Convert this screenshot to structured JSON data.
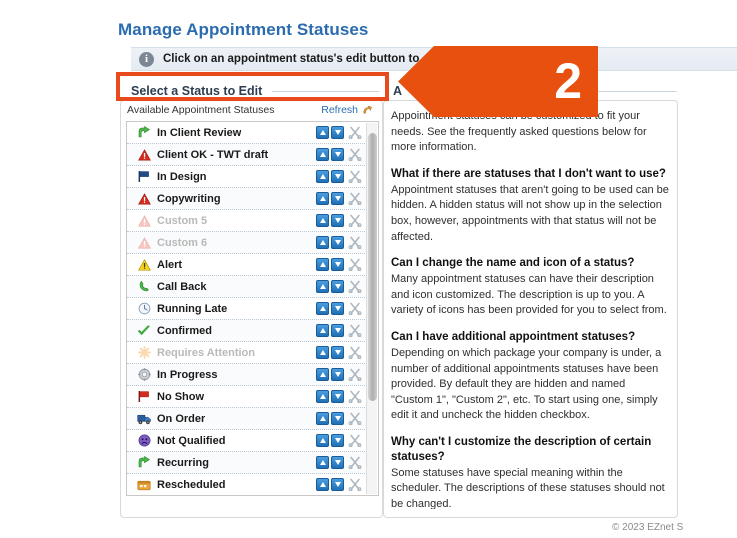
{
  "page": {
    "title": "Manage Appointment Statuses",
    "title_color": "#2b6cb0",
    "footer": "© 2023 EZnet S"
  },
  "info_bar": {
    "icon": "info-icon",
    "text": "Click on an appointment status's edit button to customize it."
  },
  "callout": {
    "number": "2",
    "color": "#e8500f",
    "direction": "left"
  },
  "highlight": {
    "color": "#e8491d"
  },
  "left_panel": {
    "section_title": "Select a Status to Edit",
    "list_header": "Available Appointment Statuses",
    "refresh_label": "Refresh",
    "refresh_icon": "refresh-icon",
    "rows": [
      {
        "name": "In Client Review",
        "icon": "green-arrow-icon",
        "disabled": false
      },
      {
        "name": "Client OK - TWT draft",
        "icon": "red-warning-icon",
        "disabled": false
      },
      {
        "name": "In Design",
        "icon": "blue-flag-icon",
        "disabled": false
      },
      {
        "name": "Copywriting",
        "icon": "red-warning-icon",
        "disabled": false
      },
      {
        "name": "Custom 5",
        "icon": "faded-warning-icon",
        "disabled": true
      },
      {
        "name": "Custom 6",
        "icon": "faded-warning-icon",
        "disabled": true
      },
      {
        "name": "Alert",
        "icon": "yellow-warning-icon",
        "disabled": false
      },
      {
        "name": "Call Back",
        "icon": "green-phone-icon",
        "disabled": false
      },
      {
        "name": "Running Late",
        "icon": "clock-icon",
        "disabled": false
      },
      {
        "name": "Confirmed",
        "icon": "green-check-icon",
        "disabled": false
      },
      {
        "name": "Requires Attention",
        "icon": "faded-asterisk-icon",
        "disabled": true
      },
      {
        "name": "In Progress",
        "icon": "gray-gear-icon",
        "disabled": false
      },
      {
        "name": "No Show",
        "icon": "red-flag-icon",
        "disabled": false
      },
      {
        "name": "On Order",
        "icon": "blue-truck-icon",
        "disabled": false
      },
      {
        "name": "Not Qualified",
        "icon": "purple-face-icon",
        "disabled": false
      },
      {
        "name": "Recurring",
        "icon": "green-arrow-icon",
        "disabled": false
      },
      {
        "name": "Rescheduled",
        "icon": "orange-calendar-icon",
        "disabled": false
      }
    ],
    "row_actions": {
      "move_up": "move-up-button",
      "move_down": "move-down-button",
      "edit": "edit-scissors-button"
    }
  },
  "right_panel": {
    "section_title": "A",
    "intro": "Appointment statuses can be customized to fit your needs. See the frequently asked questions below for more information.",
    "faqs": [
      {
        "question": "What if there are statuses that I don't want to use?",
        "answer": "Appointment statuses that aren't going to be used can be hidden. A hidden status will not show up in the selection box, however, appointments with that status will not be affected."
      },
      {
        "question": "Can I change the name and icon of a status?",
        "answer": "Many appointment statuses can have their description and icon customized. The description is up to you. A variety of icons has been provided for you to select from."
      },
      {
        "question": "Can I have additional appointment statuses?",
        "answer": "Depending on which package your company is under, a number of additional appointments statuses have been provided. By default they are hidden and named \"Custom 1\", \"Custom 2\", etc. To start using one, simply edit it and uncheck the hidden checkbox."
      },
      {
        "question": "Why can't I customize the description of certain statuses?",
        "answer": "Some statuses have special meaning within the scheduler. The descriptions of these statuses should not be changed."
      }
    ]
  }
}
